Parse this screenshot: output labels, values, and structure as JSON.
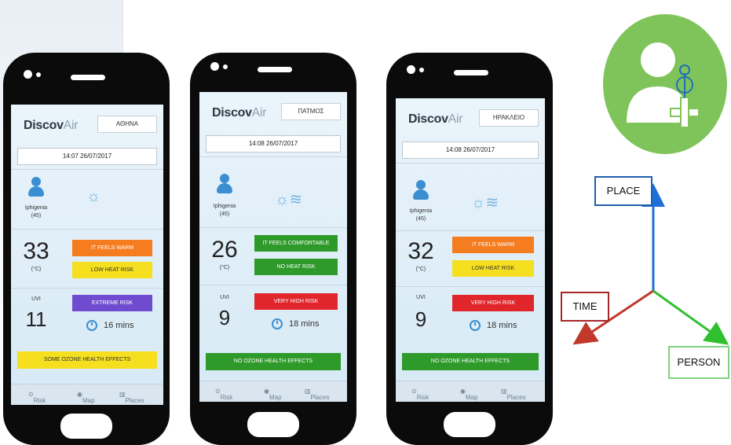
{
  "phones": [
    {
      "city": "ΑΘΗΝΑ",
      "datetime": "14:07 26/07/2017",
      "user_name": "Iphigenia",
      "user_age": "(45)",
      "temperature": "33",
      "temp_unit": "(°C)",
      "feels": "IT FEELS WARM",
      "feels_color": "#f57c1f",
      "heat_risk": "LOW HEAT RISK",
      "heat_risk_color": "#f5df1e",
      "uvi_label": "UVI",
      "uvi_value": "11",
      "uv_risk": "EXTREME RISK",
      "uv_risk_color": "#6f4ccf",
      "timer": "16 mins",
      "ozone": "SOME OZONE HEALTH EFFECTS",
      "ozone_color": "#f5df1e"
    },
    {
      "city": "ΠΑΤΜΟΣ",
      "datetime": "14:08 26/07/2017",
      "user_name": "Iphigenia",
      "user_age": "(45)",
      "temperature": "26",
      "temp_unit": "(°C)",
      "feels": "IT FEELS COMFORTABLE",
      "feels_color": "#2e9a2a",
      "heat_risk": "NO HEAT RISK",
      "heat_risk_color": "#2e9a2a",
      "uvi_label": "UVI",
      "uvi_value": "9",
      "uv_risk": "VERY HIGH RISK",
      "uv_risk_color": "#e0252b",
      "timer": "18 mins",
      "ozone": "NO OZONE HEALTH EFFECTS",
      "ozone_color": "#2e9a2a"
    },
    {
      "city": "ΗΡΑΚΛΕΙΟ",
      "datetime": "14:08 26/07/2017",
      "user_name": "Iphigenia",
      "user_age": "(45)",
      "temperature": "32",
      "temp_unit": "(°C)",
      "feels": "IT FEELS WARM",
      "feels_color": "#f57c1f",
      "heat_risk": "LOW HEAT RISK",
      "heat_risk_color": "#f5df1e",
      "uvi_label": "UVI",
      "uvi_value": "9",
      "uv_risk": "VERY HIGH RISK",
      "uv_risk_color": "#e0252b",
      "timer": "18 mins",
      "ozone": "NO OZONE HEALTH EFFECTS",
      "ozone_color": "#2e9a2a"
    }
  ],
  "app": {
    "logo_main": "Discov",
    "logo_accent": "Air"
  },
  "nav": {
    "risk": "Risk",
    "map": "Map",
    "places": "Places"
  },
  "diagram": {
    "place": "PLACE",
    "time": "TIME",
    "person": "PERSON",
    "place_color": "#1f5fb0",
    "time_color": "#a8282a",
    "person_color": "#3bbf3b",
    "avatar_color": "#7fc45a"
  }
}
